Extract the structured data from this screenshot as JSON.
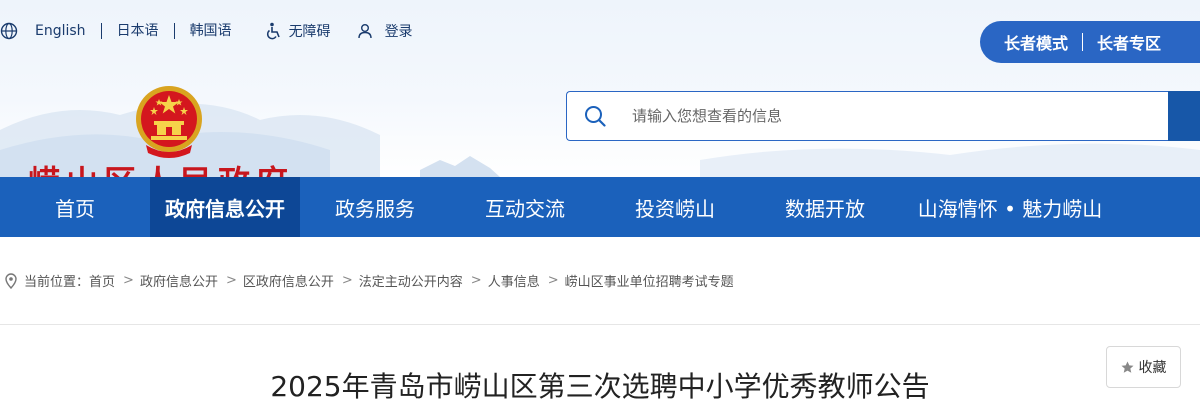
{
  "header": {
    "languages": [
      "English",
      "日本语",
      "韩国语"
    ],
    "accessibility_label": "无障碍",
    "login_label": "登录",
    "elder_mode_label": "长者模式",
    "elder_zone_label": "长者专区",
    "site_title": "崂山区人民政府",
    "emblem": "national-emblem"
  },
  "search": {
    "placeholder": "请输入您想查看的信息",
    "value": ""
  },
  "nav": {
    "items": [
      "首页",
      "政府信息公开",
      "政务服务",
      "互动交流",
      "投资崂山",
      "数据开放",
      "山海情怀 • 魅力崂山"
    ],
    "active_index": 1
  },
  "breadcrumb": {
    "prefix": "当前位置：",
    "items": [
      "首页",
      "政府信息公开",
      "区政府信息公开",
      "法定主动公开内容",
      "人事信息",
      "崂山区事业单位招聘考试专题"
    ],
    "separator": ">"
  },
  "article": {
    "favorite_label": "收藏",
    "title": "2025年青岛市崂山区第三次选聘中小学优秀教师公告"
  },
  "colors": {
    "nav_bg": "#1b61bb",
    "nav_active_bg": "#0d4796",
    "accent_blue": "#2a66c4",
    "title_red": "#c8161d"
  }
}
